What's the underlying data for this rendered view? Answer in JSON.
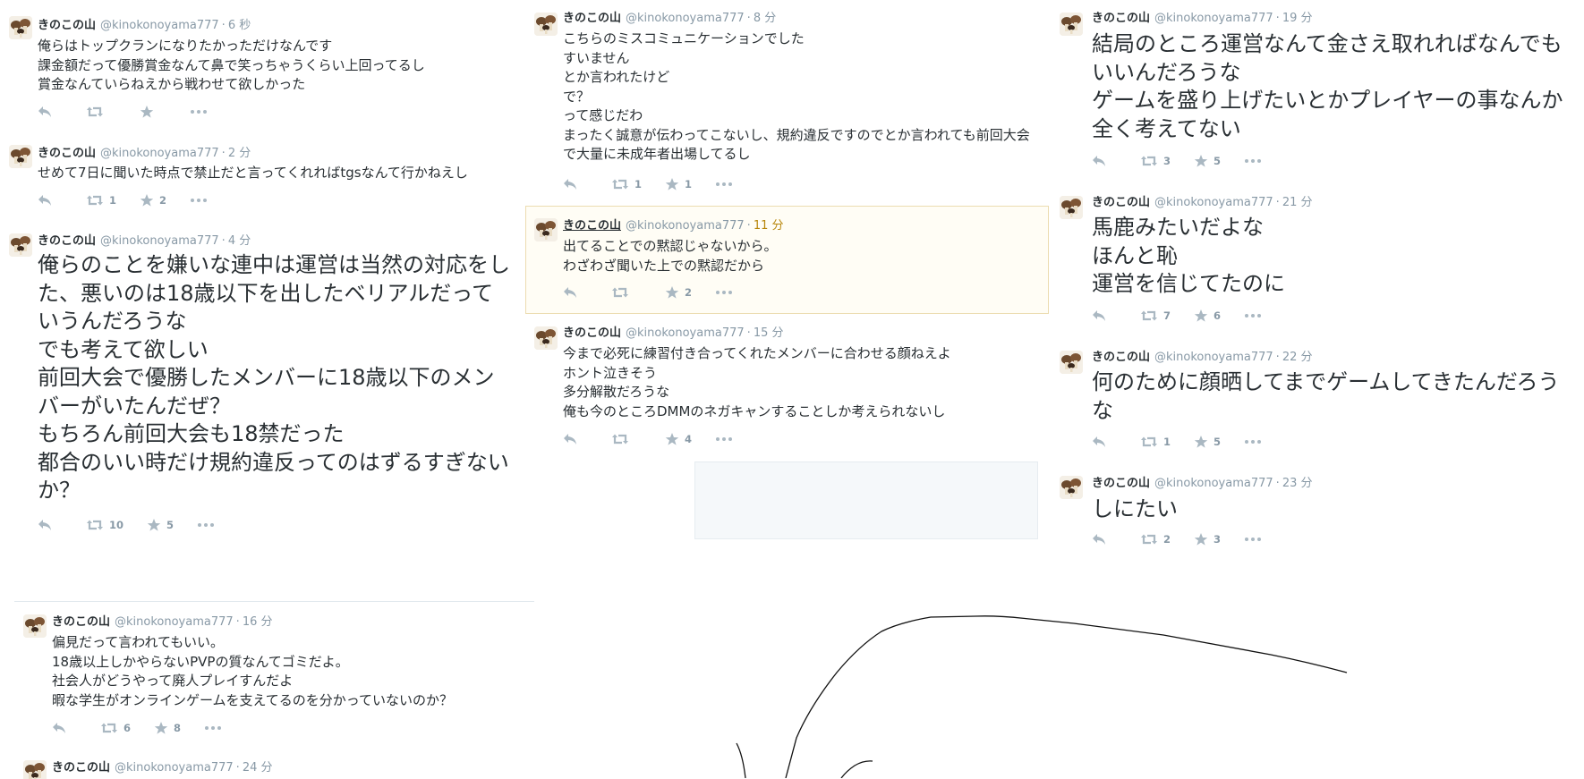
{
  "tweets": {
    "t1": {
      "name": "きのこの山",
      "handle": "@kinokonoyama777",
      "time": "6 秒",
      "text": "俺らはトップクランになりたかっただけなんです\n課金額だって優勝賞金なんて鼻で笑っちゃうくらい上回ってるし\n賞金なんていらねえから戦わせて欲しかった",
      "retweets": "",
      "favorites": ""
    },
    "t2": {
      "name": "きのこの山",
      "handle": "@kinokonoyama777",
      "time": "2 分",
      "text": "せめて7日に聞いた時点で禁止だと言ってくれればtgsなんて行かねえし",
      "retweets": "1",
      "favorites": "2"
    },
    "t3": {
      "name": "きのこの山",
      "handle": "@kinokonoyama777",
      "time": "4 分",
      "text": "俺らのことを嫌いな連中は運営は当然の対応をした、悪いのは18歳以下を出したベリアルだっていうんだろうな\nでも考えて欲しい\n前回大会で優勝したメンバーに18歳以下のメンバーがいたんだぜ？\nもちろん前回大会も18禁だった\n都合のいい時だけ規約違反ってのはずるすぎないか？",
      "retweets": "10",
      "favorites": "5"
    },
    "t4": {
      "name": "きのこの山",
      "handle": "@kinokonoyama777",
      "time": "8 分",
      "text": "こちらのミスコミュニケーションでした\nすいません\nとか言われたけど\nで？\nって感じだわ\nまったく誠意が伝わってこないし、規約違反ですのでとか言われても前回大会で大量に未成年者出場してるし",
      "retweets": "1",
      "favorites": "1"
    },
    "t5": {
      "name": "きのこの山",
      "handle": "@kinokonoyama777",
      "time": "11 分",
      "text": "出てることでの黙認じゃないから。\nわざわざ聞いた上での黙認だから",
      "retweets": "",
      "favorites": "2"
    },
    "t6": {
      "name": "きのこの山",
      "handle": "@kinokonoyama777",
      "time": "15 分",
      "text": "今まで必死に練習付き合ってくれたメンバーに合わせる顔ねえよ\nホント泣きそう\n多分解散だろうな\n俺も今のところDMMのネガキャンすることしか考えられないし",
      "retweets": "",
      "favorites": "4"
    },
    "t7": {
      "name": "きのこの山",
      "handle": "@kinokonoyama777",
      "time": "19 分",
      "text": "結局のところ運営なんて金さえ取れればなんでもいいんだろうな\nゲームを盛り上げたいとかプレイヤーの事なんか全く考えてない",
      "retweets": "3",
      "favorites": "5"
    },
    "t8": {
      "name": "きのこの山",
      "handle": "@kinokonoyama777",
      "time": "21 分",
      "text": "馬鹿みたいだよな\nほんと恥\n運営を信じてたのに",
      "retweets": "7",
      "favorites": "6"
    },
    "t9": {
      "name": "きのこの山",
      "handle": "@kinokonoyama777",
      "time": "22 分",
      "text": "何のために顔晒してまでゲームしてきたんだろうな",
      "retweets": "1",
      "favorites": "5"
    },
    "t10": {
      "name": "きのこの山",
      "handle": "@kinokonoyama777",
      "time": "23 分",
      "text": "しにたい",
      "retweets": "2",
      "favorites": "3"
    },
    "t11": {
      "name": "きのこの山",
      "handle": "@kinokonoyama777",
      "time": "16 分",
      "text": "偏見だって言われてもいい。\n18歳以上しかやらないPVPの質なんてゴミだよ。\n社会人がどうやって廃人プレイすんだよ\n暇な学生がオンラインゲームを支えてるのを分かっていないのか？",
      "retweets": "6",
      "favorites": "8"
    },
    "t12": {
      "name": "きのこの山",
      "handle": "@kinokonoyama777",
      "time": "24 分"
    }
  },
  "icons": {
    "avatar": "mushroom-avatar-icon",
    "reply": "reply-icon",
    "retweet": "retweet-icon",
    "favorite": "star-icon",
    "more": "more-dots-icon"
  },
  "colors": {
    "text": "#292f33",
    "muted": "#8899a6",
    "action_icon": "#aab8c2",
    "border": "#e1e8ed",
    "highlight_time": "#b8860b"
  }
}
